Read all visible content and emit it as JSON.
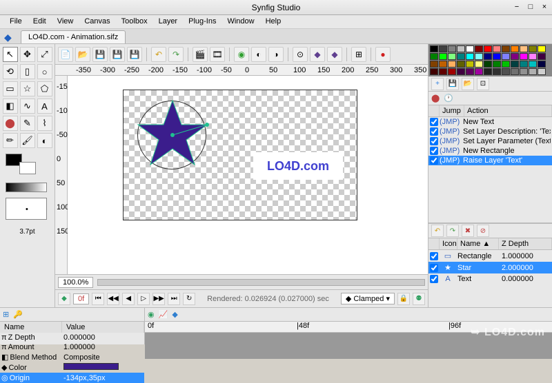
{
  "window": {
    "title": "Synfig Studio"
  },
  "menus": [
    "File",
    "Edit",
    "View",
    "Canvas",
    "Toolbox",
    "Layer",
    "Plug-Ins",
    "Window",
    "Help"
  ],
  "tab": {
    "label": "LO4D.com - Animation.sifz"
  },
  "brush": {
    "size": "3.7pt"
  },
  "ruler_h": [
    "-350",
    "-300",
    "-250",
    "-200",
    "-150",
    "-100",
    "-50",
    "0",
    "50",
    "100",
    "150",
    "200",
    "250",
    "300",
    "350"
  ],
  "ruler_v": [
    "-150",
    "-100",
    "-50",
    "0",
    "50",
    "100",
    "150"
  ],
  "zoom": {
    "value": "100.0%"
  },
  "transport": {
    "frame": "0f",
    "rendered": "Rendered: 0.026924 (0.027000) sec",
    "mode": "Clamped"
  },
  "canvas": {
    "text": "LO4D.com"
  },
  "history": {
    "cols": [
      "",
      "Jump",
      "Action"
    ],
    "rows": [
      {
        "jump": "(JMP)",
        "action": "New Text"
      },
      {
        "jump": "(JMP)",
        "action": "Set Layer Description: 'Text' -> 'Text'"
      },
      {
        "jump": "(JMP)",
        "action": "Set Layer Parameter (Text):Origin"
      },
      {
        "jump": "(JMP)",
        "action": "New Rectangle"
      },
      {
        "jump": "(JMP)",
        "action": "Raise Layer 'Text'",
        "sel": true
      }
    ]
  },
  "layers": {
    "cols": [
      "",
      "Icon",
      "Name ▲",
      "Z Depth"
    ],
    "rows": [
      {
        "name": "Rectangle",
        "z": "1.000000"
      },
      {
        "name": "Star",
        "z": "2.000000",
        "sel": true
      },
      {
        "name": "Text",
        "z": "0.000000"
      }
    ]
  },
  "params": {
    "cols": [
      "Name",
      "Value"
    ],
    "rows": [
      {
        "name": "Z Depth",
        "value": "0.000000",
        "icon": "π"
      },
      {
        "name": "Amount",
        "value": "1.000000",
        "icon": "π"
      },
      {
        "name": "Blend Method",
        "value": "Composite",
        "icon": "◧"
      },
      {
        "name": "Color",
        "value": "",
        "icon": "◆",
        "color": "#3b1d8c"
      },
      {
        "name": "Origin",
        "value": "-134px,35px",
        "icon": "◎",
        "sel": true
      }
    ]
  },
  "timeline": {
    "marks": [
      "0f",
      "|48f",
      "|96f"
    ]
  },
  "palette_colors": [
    [
      "#000",
      "#404040",
      "#808080",
      "#c0c0c0",
      "#fff",
      "#800000",
      "#f00",
      "#ff8080",
      "#804000",
      "#ff8000",
      "#ffc080",
      "#808000",
      "#ff0"
    ],
    [
      "#008000",
      "#0f0",
      "#80ff80",
      "#008080",
      "#0ff",
      "#80ffff",
      "#000080",
      "#00f",
      "#8080ff",
      "#800080",
      "#f0f",
      "#ff80ff",
      "#400040"
    ],
    [
      "#804000",
      "#c06000",
      "#ffb060",
      "#606000",
      "#c0c000",
      "#ffff80",
      "#004000",
      "#008000",
      "#00c000",
      "#004040",
      "#008080",
      "#00c0c0",
      "#000040"
    ],
    [
      "#400000",
      "#600000",
      "#a00000",
      "#400040",
      "#600060",
      "#a000a0",
      "#202020",
      "#303030",
      "#505050",
      "#707070",
      "#909090",
      "#b0b0b0",
      "#d0d0d0"
    ]
  ],
  "watermark": "➥ LO4D.com"
}
